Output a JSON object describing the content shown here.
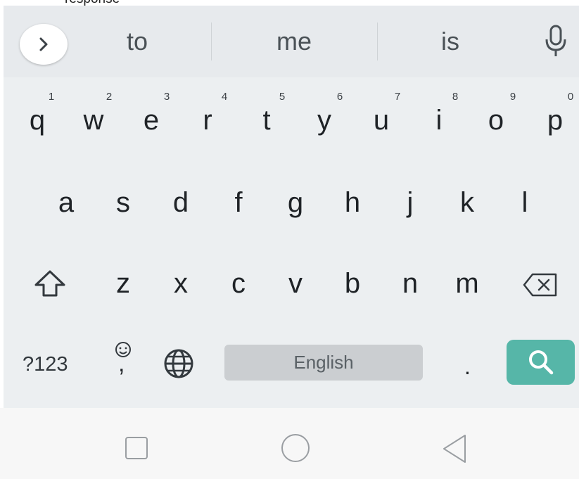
{
  "top": {
    "partial_text": "response"
  },
  "suggestions": [
    "to",
    "me",
    "is"
  ],
  "row1": [
    {
      "key": "q",
      "hint": "1"
    },
    {
      "key": "w",
      "hint": "2"
    },
    {
      "key": "e",
      "hint": "3"
    },
    {
      "key": "r",
      "hint": "4"
    },
    {
      "key": "t",
      "hint": "5"
    },
    {
      "key": "y",
      "hint": "6"
    },
    {
      "key": "u",
      "hint": "7"
    },
    {
      "key": "i",
      "hint": "8"
    },
    {
      "key": "o",
      "hint": "9"
    },
    {
      "key": "p",
      "hint": "0"
    }
  ],
  "row2": [
    "a",
    "s",
    "d",
    "f",
    "g",
    "h",
    "j",
    "k",
    "l"
  ],
  "row3": [
    "z",
    "x",
    "c",
    "v",
    "b",
    "n",
    "m"
  ],
  "bottom": {
    "symbols_label": "?123",
    "emoji_comma": ",",
    "space_label": "English",
    "period": "."
  },
  "icons": {
    "expand": "chevron-right-icon",
    "mic": "microphone-icon",
    "shift": "shift-icon",
    "backspace": "backspace-icon",
    "emoji": "emoji-icon",
    "globe": "globe-icon",
    "search": "search-icon",
    "recents": "square-icon",
    "home": "circle-icon",
    "back": "triangle-back-icon"
  },
  "colors": {
    "search_accent": "#56b6a8",
    "suggest_bar": "#e7eaed",
    "keyboard_bg": "#eceff1",
    "space_key": "#cbced1"
  }
}
